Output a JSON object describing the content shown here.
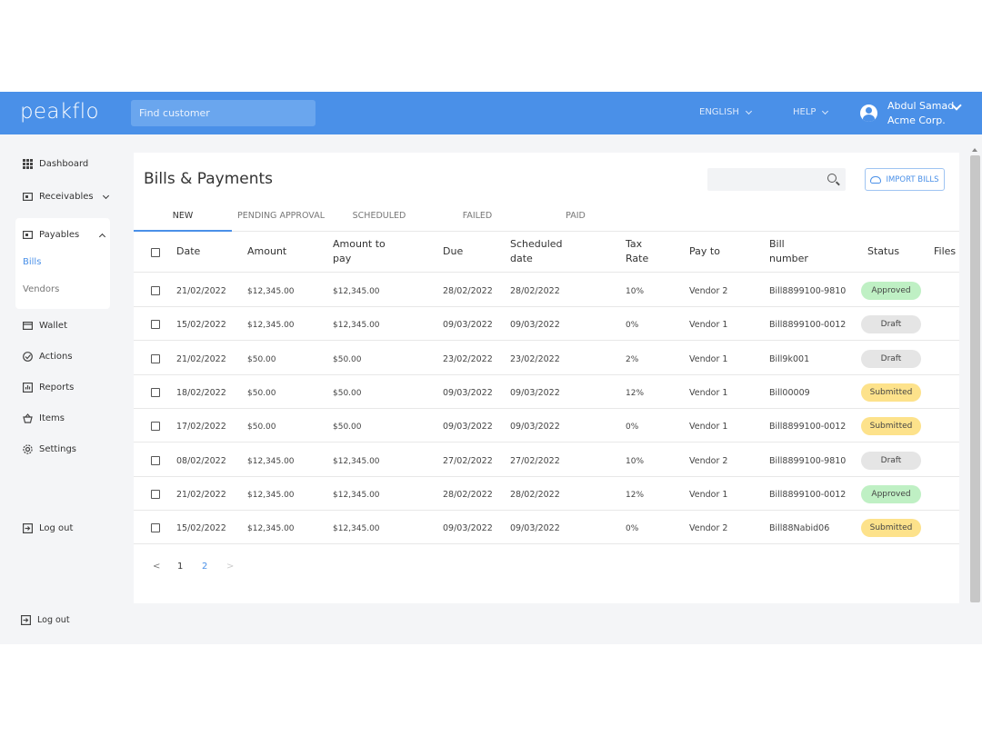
{
  "app": {
    "logo": "peakflo",
    "search_placeholder": "Find customer",
    "language": "ENGLISH",
    "help": "HELP",
    "user_name": "Abdul Samad",
    "user_org": "Acme Corp."
  },
  "sidebar": {
    "dashboard": "Dashboard",
    "receivables": "Receivables",
    "payables": "Payables",
    "bills": "Bills",
    "vendors": "Vendors",
    "wallet": "Wallet",
    "actions": "Actions",
    "reports": "Reports",
    "items": "Items",
    "settings": "Settings",
    "logout": "Log out",
    "logout_bottom": "Log out"
  },
  "main": {
    "title": "Bills & Payments",
    "import_label": "IMPORT BILLS",
    "tabs": [
      "NEW",
      "PENDING APPROVAL",
      "SCHEDULED",
      "FAILED",
      "PAID"
    ],
    "headers": {
      "date": "Date",
      "amount": "Amount",
      "amount_to_pay_1": "Amount to",
      "amount_to_pay_2": "pay",
      "due": "Due",
      "scheduled_1": "Scheduled",
      "scheduled_2": "date",
      "tax_1": "Tax",
      "tax_2": "Rate",
      "pay_to": "Pay to",
      "bill_1": "Bill",
      "bill_2": "number",
      "status": "Status",
      "files": "Files"
    },
    "rows": [
      {
        "date": "21/02/2022",
        "amount": "$12,345.00",
        "to_pay": "$12,345.00",
        "due": "28/02/2022",
        "scheduled": "28/02/2022",
        "tax": "10%",
        "pay_to": "Vendor 2",
        "bill": "Bill8899100-9810",
        "status": "Approved"
      },
      {
        "date": "15/02/2022",
        "amount": "$12,345.00",
        "to_pay": "$12,345.00",
        "due": "09/03/2022",
        "scheduled": "09/03/2022",
        "tax": "0%",
        "pay_to": "Vendor 1",
        "bill": "Bill8899100-0012",
        "status": "Draft"
      },
      {
        "date": "21/02/2022",
        "amount": "$50.00",
        "to_pay": "$50.00",
        "due": "23/02/2022",
        "scheduled": "23/02/2022",
        "tax": "2%",
        "pay_to": "Vendor 1",
        "bill": "Bill9k001",
        "status": "Draft"
      },
      {
        "date": "18/02/2022",
        "amount": "$50.00",
        "to_pay": "$50.00",
        "due": "09/03/2022",
        "scheduled": "09/03/2022",
        "tax": "12%",
        "pay_to": "Vendor 1",
        "bill": "Bill00009",
        "status": "Submitted"
      },
      {
        "date": "17/02/2022",
        "amount": "$50.00",
        "to_pay": "$50.00",
        "due": "09/03/2022",
        "scheduled": "09/03/2022",
        "tax": "0%",
        "pay_to": "Vendor 1",
        "bill": "Bill8899100-0012",
        "status": "Submitted"
      },
      {
        "date": "08/02/2022",
        "amount": "$12,345.00",
        "to_pay": "$12,345.00",
        "due": "27/02/2022",
        "scheduled": "27/02/2022",
        "tax": "10%",
        "pay_to": "Vendor 2",
        "bill": "Bill8899100-9810",
        "status": "Draft"
      },
      {
        "date": "21/02/2022",
        "amount": "$12,345.00",
        "to_pay": "$12,345.00",
        "due": "28/02/2022",
        "scheduled": "28/02/2022",
        "tax": "12%",
        "pay_to": "Vendor 1",
        "bill": "Bill8899100-0012",
        "status": "Approved"
      },
      {
        "date": "15/02/2022",
        "amount": "$12,345.00",
        "to_pay": "$12,345.00",
        "due": "09/03/2022",
        "scheduled": "09/03/2022",
        "tax": "0%",
        "pay_to": "Vendor 2",
        "bill": "Bill88Nabid06",
        "status": "Submitted"
      }
    ],
    "pagination": {
      "prev": "<",
      "pages": [
        "1",
        "2"
      ],
      "next": ">",
      "current": "2"
    }
  },
  "colors": {
    "brand": "#4a90e8",
    "approved": "#bff0c4",
    "draft": "#e5e5e5",
    "submitted": "#fde28b"
  }
}
